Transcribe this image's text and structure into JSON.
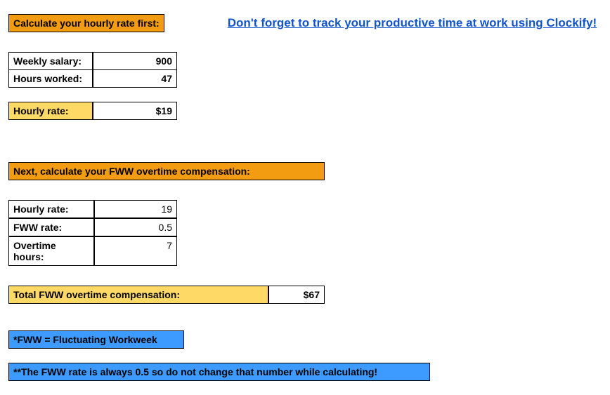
{
  "header": {
    "title": "Calculate your hourly rate first:",
    "promo": "Don't forget to track your productive time at work using Clockify!"
  },
  "inputs1": {
    "weekly_salary_label": "Weekly salary:",
    "weekly_salary_value": "900",
    "hours_worked_label": "Hours worked:",
    "hours_worked_value": "47"
  },
  "result1": {
    "hourly_rate_label": "Hourly rate:",
    "hourly_rate_value": "$19"
  },
  "header2": {
    "title": "Next, calculate your FWW overtime compensation:"
  },
  "inputs2": {
    "hourly_rate_label": "Hourly rate:",
    "hourly_rate_value": "19",
    "fww_rate_label": "FWW rate:",
    "fww_rate_value": "0.5",
    "overtime_hours_label": "Overtime hours:",
    "overtime_hours_value": "7"
  },
  "result2": {
    "total_label": "Total FWW overtime compensation:",
    "total_value": "$67"
  },
  "notes": {
    "note1": "*FWW = Fluctuating Workweek",
    "note2": "**The FWW rate is always 0.5 so do not change that number while calculating!"
  }
}
